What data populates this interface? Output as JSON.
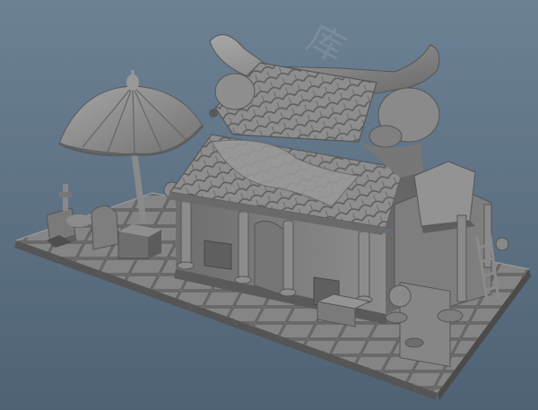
{
  "viewport": {
    "background_top": "#6d8195",
    "background_bottom": "#4f6275",
    "model_color": "#8a8a8a",
    "shadow_color": "#4a4a4a",
    "highlight_color": "#b4b4b4"
  },
  "watermark": {
    "text": "库"
  }
}
